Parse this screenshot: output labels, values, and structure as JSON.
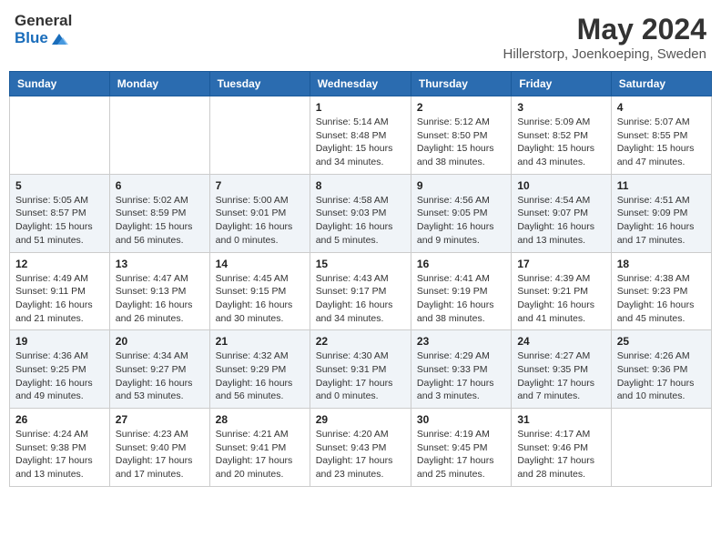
{
  "logo": {
    "general": "General",
    "blue": "Blue"
  },
  "title": "May 2024",
  "subtitle": "Hillerstorp, Joenkoeping, Sweden",
  "days_of_week": [
    "Sunday",
    "Monday",
    "Tuesday",
    "Wednesday",
    "Thursday",
    "Friday",
    "Saturday"
  ],
  "weeks": [
    [
      {
        "day": "",
        "info": ""
      },
      {
        "day": "",
        "info": ""
      },
      {
        "day": "",
        "info": ""
      },
      {
        "day": "1",
        "info": "Sunrise: 5:14 AM\nSunset: 8:48 PM\nDaylight: 15 hours and 34 minutes."
      },
      {
        "day": "2",
        "info": "Sunrise: 5:12 AM\nSunset: 8:50 PM\nDaylight: 15 hours and 38 minutes."
      },
      {
        "day": "3",
        "info": "Sunrise: 5:09 AM\nSunset: 8:52 PM\nDaylight: 15 hours and 43 minutes."
      },
      {
        "day": "4",
        "info": "Sunrise: 5:07 AM\nSunset: 8:55 PM\nDaylight: 15 hours and 47 minutes."
      }
    ],
    [
      {
        "day": "5",
        "info": "Sunrise: 5:05 AM\nSunset: 8:57 PM\nDaylight: 15 hours and 51 minutes."
      },
      {
        "day": "6",
        "info": "Sunrise: 5:02 AM\nSunset: 8:59 PM\nDaylight: 15 hours and 56 minutes."
      },
      {
        "day": "7",
        "info": "Sunrise: 5:00 AM\nSunset: 9:01 PM\nDaylight: 16 hours and 0 minutes."
      },
      {
        "day": "8",
        "info": "Sunrise: 4:58 AM\nSunset: 9:03 PM\nDaylight: 16 hours and 5 minutes."
      },
      {
        "day": "9",
        "info": "Sunrise: 4:56 AM\nSunset: 9:05 PM\nDaylight: 16 hours and 9 minutes."
      },
      {
        "day": "10",
        "info": "Sunrise: 4:54 AM\nSunset: 9:07 PM\nDaylight: 16 hours and 13 minutes."
      },
      {
        "day": "11",
        "info": "Sunrise: 4:51 AM\nSunset: 9:09 PM\nDaylight: 16 hours and 17 minutes."
      }
    ],
    [
      {
        "day": "12",
        "info": "Sunrise: 4:49 AM\nSunset: 9:11 PM\nDaylight: 16 hours and 21 minutes."
      },
      {
        "day": "13",
        "info": "Sunrise: 4:47 AM\nSunset: 9:13 PM\nDaylight: 16 hours and 26 minutes."
      },
      {
        "day": "14",
        "info": "Sunrise: 4:45 AM\nSunset: 9:15 PM\nDaylight: 16 hours and 30 minutes."
      },
      {
        "day": "15",
        "info": "Sunrise: 4:43 AM\nSunset: 9:17 PM\nDaylight: 16 hours and 34 minutes."
      },
      {
        "day": "16",
        "info": "Sunrise: 4:41 AM\nSunset: 9:19 PM\nDaylight: 16 hours and 38 minutes."
      },
      {
        "day": "17",
        "info": "Sunrise: 4:39 AM\nSunset: 9:21 PM\nDaylight: 16 hours and 41 minutes."
      },
      {
        "day": "18",
        "info": "Sunrise: 4:38 AM\nSunset: 9:23 PM\nDaylight: 16 hours and 45 minutes."
      }
    ],
    [
      {
        "day": "19",
        "info": "Sunrise: 4:36 AM\nSunset: 9:25 PM\nDaylight: 16 hours and 49 minutes."
      },
      {
        "day": "20",
        "info": "Sunrise: 4:34 AM\nSunset: 9:27 PM\nDaylight: 16 hours and 53 minutes."
      },
      {
        "day": "21",
        "info": "Sunrise: 4:32 AM\nSunset: 9:29 PM\nDaylight: 16 hours and 56 minutes."
      },
      {
        "day": "22",
        "info": "Sunrise: 4:30 AM\nSunset: 9:31 PM\nDaylight: 17 hours and 0 minutes."
      },
      {
        "day": "23",
        "info": "Sunrise: 4:29 AM\nSunset: 9:33 PM\nDaylight: 17 hours and 3 minutes."
      },
      {
        "day": "24",
        "info": "Sunrise: 4:27 AM\nSunset: 9:35 PM\nDaylight: 17 hours and 7 minutes."
      },
      {
        "day": "25",
        "info": "Sunrise: 4:26 AM\nSunset: 9:36 PM\nDaylight: 17 hours and 10 minutes."
      }
    ],
    [
      {
        "day": "26",
        "info": "Sunrise: 4:24 AM\nSunset: 9:38 PM\nDaylight: 17 hours and 13 minutes."
      },
      {
        "day": "27",
        "info": "Sunrise: 4:23 AM\nSunset: 9:40 PM\nDaylight: 17 hours and 17 minutes."
      },
      {
        "day": "28",
        "info": "Sunrise: 4:21 AM\nSunset: 9:41 PM\nDaylight: 17 hours and 20 minutes."
      },
      {
        "day": "29",
        "info": "Sunrise: 4:20 AM\nSunset: 9:43 PM\nDaylight: 17 hours and 23 minutes."
      },
      {
        "day": "30",
        "info": "Sunrise: 4:19 AM\nSunset: 9:45 PM\nDaylight: 17 hours and 25 minutes."
      },
      {
        "day": "31",
        "info": "Sunrise: 4:17 AM\nSunset: 9:46 PM\nDaylight: 17 hours and 28 minutes."
      },
      {
        "day": "",
        "info": ""
      }
    ]
  ]
}
